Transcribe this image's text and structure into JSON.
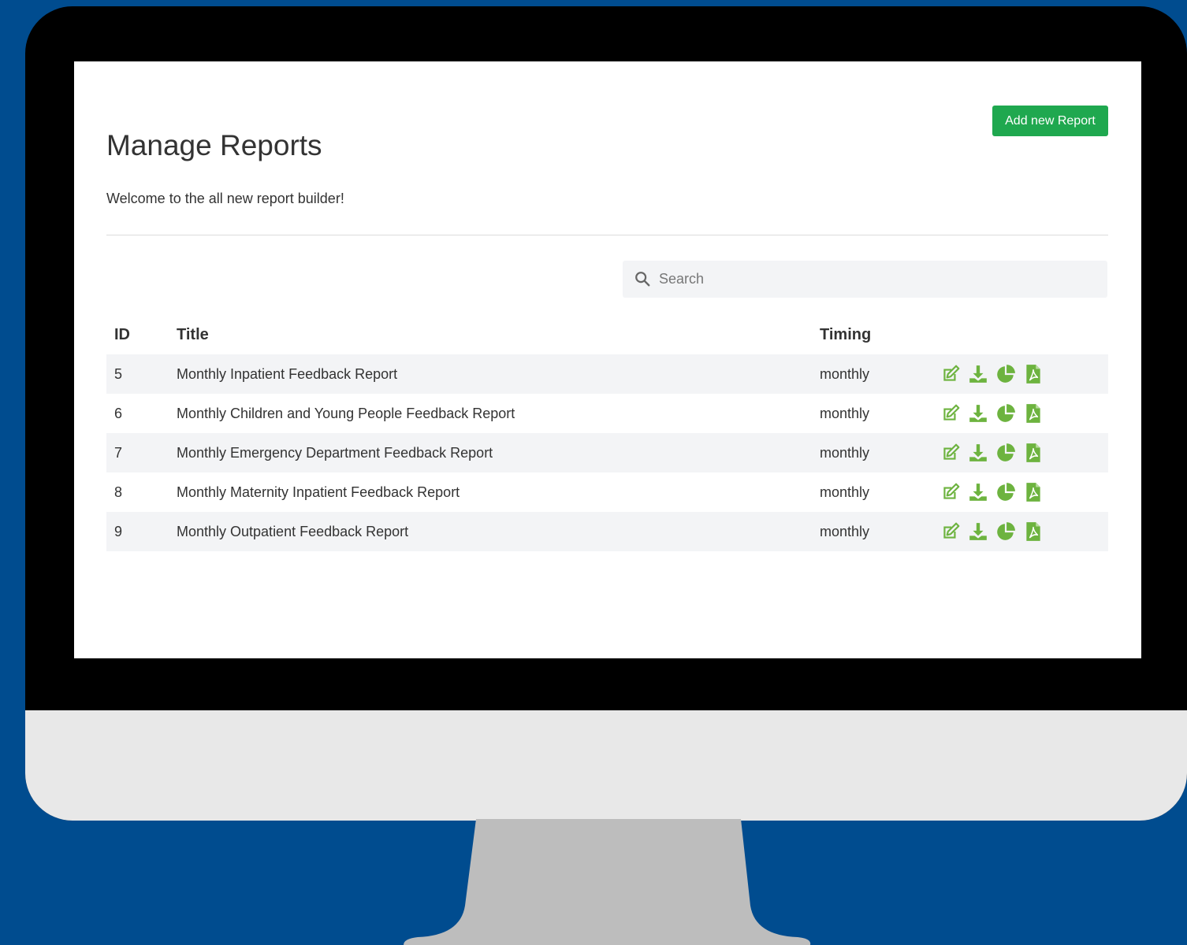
{
  "page": {
    "title": "Manage Reports",
    "subtitle": "Welcome to the all new report builder!",
    "add_button_label": "Add new Report"
  },
  "search": {
    "placeholder": "Search",
    "value": "",
    "icon": "search-icon"
  },
  "table": {
    "columns": [
      "ID",
      "Title",
      "Timing",
      ""
    ],
    "rows": [
      {
        "id": "5",
        "title": "Monthly Inpatient Feedback Report",
        "timing": "monthly"
      },
      {
        "id": "6",
        "title": "Monthly Children and Young People Feedback Report",
        "timing": "monthly"
      },
      {
        "id": "7",
        "title": "Monthly Emergency Department Feedback Report",
        "timing": "monthly"
      },
      {
        "id": "8",
        "title": "Monthly Maternity Inpatient Feedback Report",
        "timing": "monthly"
      },
      {
        "id": "9",
        "title": "Monthly Outpatient Feedback Report",
        "timing": "monthly"
      }
    ],
    "row_actions": [
      "edit-icon",
      "download-icon",
      "pie-chart-icon",
      "pdf-icon"
    ]
  },
  "colors": {
    "background": "#004c8f",
    "accent_button": "#1fa84f",
    "action_icon": "#6db33f"
  }
}
